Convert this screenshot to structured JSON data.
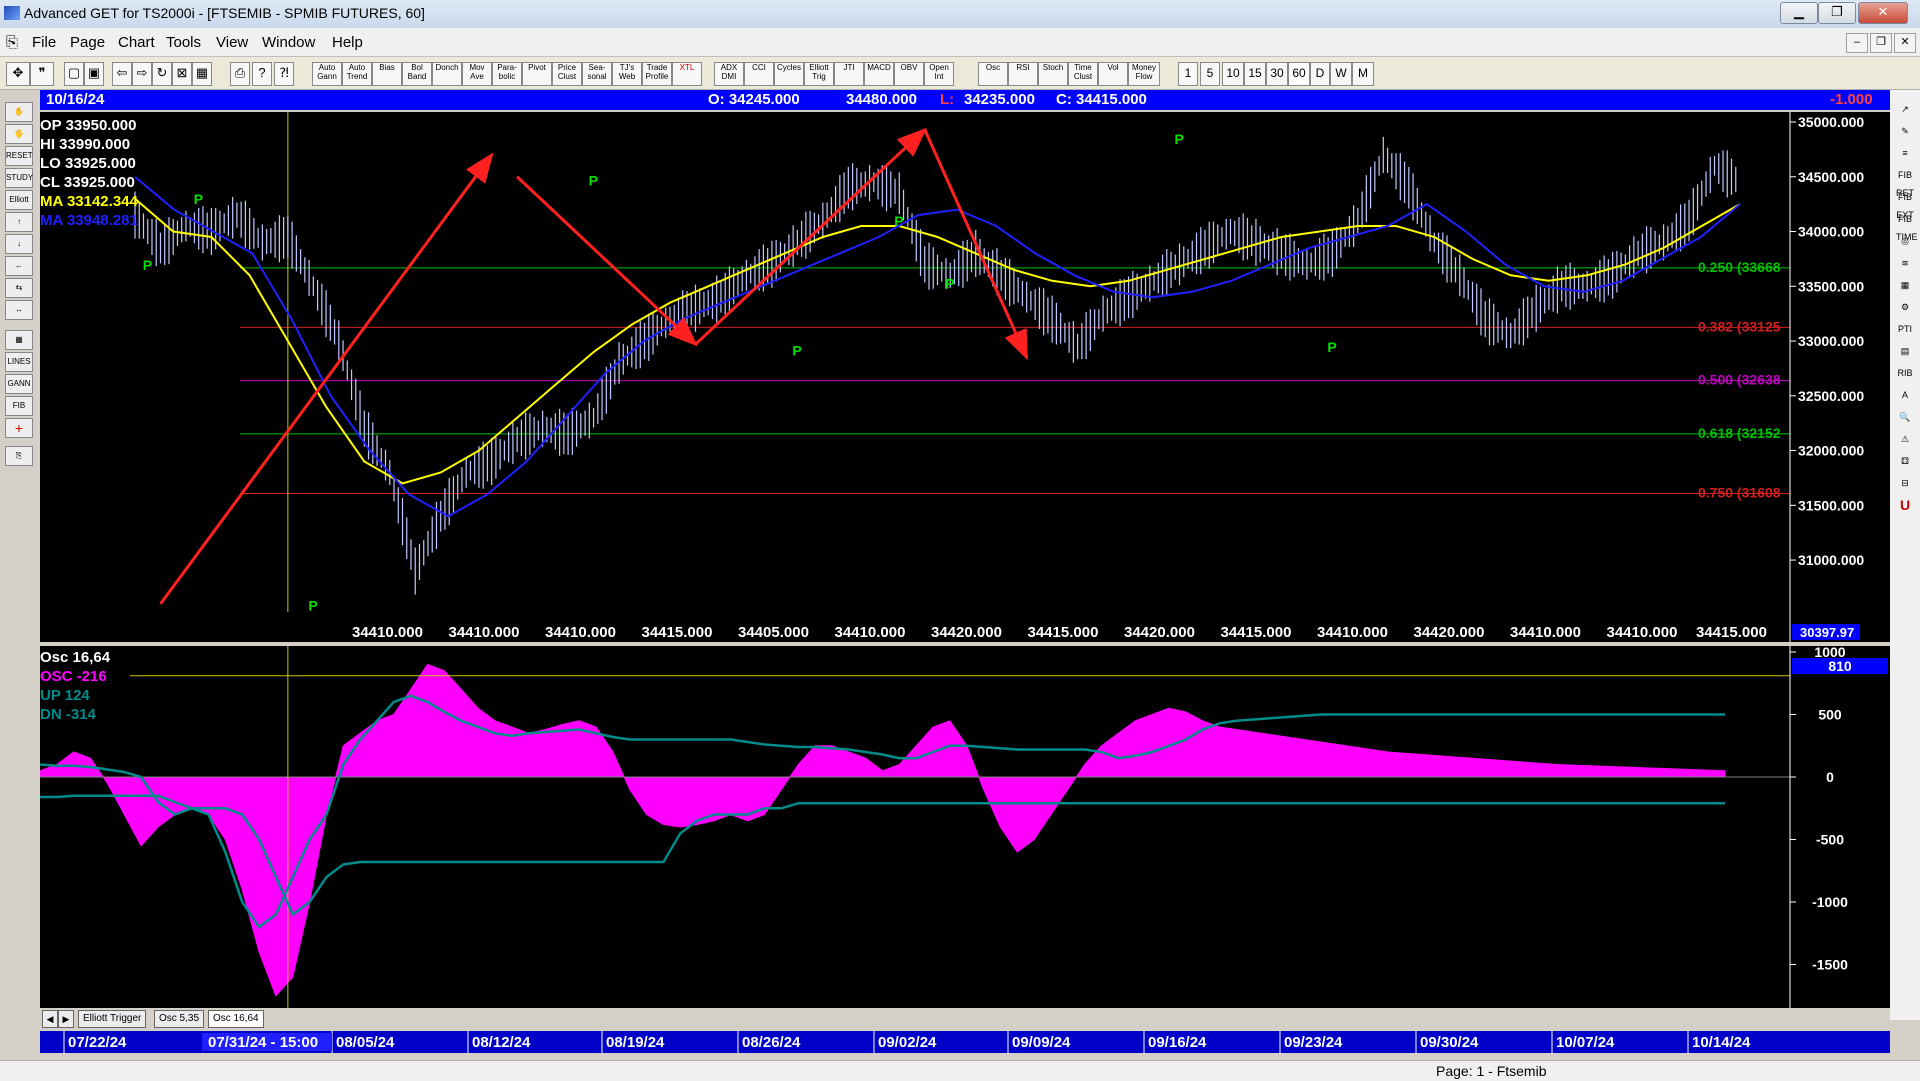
{
  "window": {
    "title": "Advanced GET for TS2000i - [FTSEMIB - SPMIB FUTURES, 60]",
    "minimize": "▁",
    "restore": "❐",
    "close": "✕"
  },
  "menu": [
    "File",
    "Page",
    "Chart",
    "Tools",
    "View",
    "Window",
    "Help"
  ],
  "toolbar": {
    "studies": [
      "Auto Gann",
      "Auto Trend",
      "Bias",
      "Bol Band",
      "Donch",
      "Mov Ave",
      "Para- bolic",
      "Pivot",
      "Price Clust",
      "Sea- sonal",
      "TJ's Web",
      "Trade Profile",
      "XTL",
      "ADX DMI",
      "CCI",
      "Cycles",
      "Elliott Trig",
      "JTI",
      "MACD",
      "OBV",
      "Open Int",
      "Osc",
      "RSI",
      "Stoch",
      "Time Clust",
      "Vol",
      "Money Flow"
    ],
    "intervals": [
      "1",
      "5",
      "10",
      "15",
      "30",
      "60",
      "D",
      "W",
      "M"
    ]
  },
  "info": {
    "date": "10/16/24",
    "open": "O: 34245.000",
    "high": "34480.000",
    "low_prefix": "L:",
    "low": "34235.000",
    "close": "C: 34415.000",
    "change": "-1.000"
  },
  "legend": {
    "op": "OP  33950.000",
    "hi": "HI   33990.000",
    "lo": "LO  33925.000",
    "cl": "CL  33925.000",
    "ma1": "MA  33142.344",
    "ma2": "MA  33948.281"
  },
  "colors": {
    "price": "#c0c8ff",
    "ma_yellow": "#ffff00",
    "ma_blue": "#2020ff",
    "arrow": "#ff2020",
    "pivot": "#00e000",
    "osc": "#ff00ff",
    "osc_line": "#008b8b",
    "fib_green": "#00c000",
    "fib_red": "#d02020",
    "fib_purple": "#c000c0"
  },
  "chart_data": [
    {
      "type": "line",
      "ylim": [
        30397.97,
        35000
      ],
      "yticks": [
        {
          "v": 35000,
          "label": "35000.000"
        },
        {
          "v": 34500,
          "label": "34500.000"
        },
        {
          "v": 34000,
          "label": "34000.000"
        },
        {
          "v": 33500,
          "label": "33500.000"
        },
        {
          "v": 33000,
          "label": "33000.000"
        },
        {
          "v": 32500,
          "label": "32500.000"
        },
        {
          "v": 32000,
          "label": "32000.000"
        },
        {
          "v": 31500,
          "label": "31500.000"
        },
        {
          "v": 31000,
          "label": "31000.000"
        }
      ],
      "y_bottom_label": "30397.97",
      "series": [
        {
          "values": [
            34150,
            33850,
            34050,
            34000,
            34150,
            33900,
            33950,
            33500,
            33000,
            32200,
            31800,
            30900,
            31400,
            31800,
            31900,
            32100,
            32200,
            32150,
            32300,
            32800,
            33000,
            33200,
            33300,
            33400,
            33600,
            33700,
            33900,
            34100,
            34400,
            34450,
            34350,
            33700,
            33600,
            33800,
            33600,
            33400,
            33200,
            32950,
            33250,
            33400,
            33550,
            33700,
            33850,
            34000,
            33900,
            33800,
            33700,
            33800,
            34100,
            34700,
            34400,
            33900,
            33600,
            33200,
            33050,
            33300,
            33500,
            33500,
            33600,
            33800,
            33900,
            34100,
            34600,
            34450
          ]
        },
        {
          "values": [
            34300,
            34000,
            33950,
            33600,
            33000,
            32400,
            31900,
            31700,
            31800,
            32000,
            32300,
            32600,
            32900,
            33150,
            33350,
            33500,
            33650,
            33800,
            33950,
            34050,
            34050,
            33950,
            33800,
            33650,
            33550,
            33500,
            33550,
            33650,
            33750,
            33850,
            33950,
            34000,
            34050,
            34050,
            33950,
            33750,
            33600,
            33550,
            33600,
            33700,
            33850,
            34050,
            34250
          ]
        },
        {
          "values": [
            34500,
            34200,
            34000,
            33800,
            33200,
            32500,
            32000,
            31600,
            31400,
            31600,
            31900,
            32300,
            32700,
            33000,
            33200,
            33350,
            33500,
            33650,
            33800,
            33950,
            34150,
            34200,
            34050,
            33800,
            33600,
            33450,
            33400,
            33450,
            33550,
            33700,
            33850,
            33950,
            34050,
            34250,
            34000,
            33700,
            33500,
            33450,
            33550,
            33750,
            33950,
            34250
          ]
        }
      ],
      "trendlines": [
        [
          1,
          30600,
          14,
          34700
        ],
        [
          15,
          34500,
          22,
          32970
        ],
        [
          22,
          32970,
          31,
          34930
        ],
        [
          31,
          34930,
          35,
          32850
        ]
      ],
      "pivots": [
        {
          "x": 0.5,
          "y": 33650,
          "label": "P"
        },
        {
          "x": 2.5,
          "y": 34250,
          "label": "P"
        },
        {
          "x": 7,
          "y": 30540,
          "label": "P"
        },
        {
          "x": 18,
          "y": 34420,
          "label": "P"
        },
        {
          "x": 26,
          "y": 32870,
          "label": "P"
        },
        {
          "x": 30,
          "y": 34050,
          "label": "P"
        },
        {
          "x": 32,
          "y": 33480,
          "label": "P"
        },
        {
          "x": 41,
          "y": 34800,
          "label": "P"
        },
        {
          "x": 47,
          "y": 32900,
          "label": "P"
        }
      ],
      "fib_levels": [
        {
          "v": 33668,
          "label": "0.250 (33668"
        },
        {
          "v": 33125,
          "label": "0.382 (33125"
        },
        {
          "v": 32638,
          "label": "0.500 (32638"
        },
        {
          "v": 32152,
          "label": "0.618 (32152"
        },
        {
          "v": 31608,
          "label": "0.750 (31608"
        }
      ],
      "time_cursor_x": 6,
      "bottom_labels": [
        "34410.000",
        "34410.000",
        "34410.000",
        "34415.000",
        "34405.000",
        "34410.000",
        "34420.000",
        "34415.000",
        "34420.000",
        "34415.000",
        "34410.000",
        "34420.000",
        "34410.000",
        "34410.000",
        "34415.000"
      ]
    },
    {
      "type": "area",
      "title": "Osc 16,64",
      "legend": {
        "osc": "OSC -216",
        "up": "UP   124",
        "dn": "DN   -314"
      },
      "ylim": [
        -1800,
        1000
      ],
      "yticks": [
        {
          "v": 1000,
          "label": "1000"
        },
        {
          "v": 500,
          "label": "500"
        },
        {
          "v": 0,
          "label": "0"
        },
        {
          "v": -500,
          "label": "-500"
        },
        {
          "v": -1000,
          "label": "-1000"
        },
        {
          "v": -1500,
          "label": "-1500"
        }
      ],
      "readout": "810",
      "threshold": 810,
      "x": [
        0,
        2,
        4,
        6,
        8,
        10,
        12,
        14,
        16,
        18,
        20,
        22,
        24,
        26,
        28,
        30,
        32,
        34,
        36,
        38,
        40,
        42,
        44,
        46,
        48,
        50,
        52,
        54,
        56,
        58,
        60,
        62,
        64,
        66,
        68,
        70,
        72,
        74,
        76,
        78,
        80,
        82,
        84,
        86,
        88,
        90,
        92,
        94,
        96,
        98,
        100,
        102,
        104,
        106,
        108,
        110,
        112,
        114,
        116,
        118,
        120,
        122,
        124,
        126,
        128,
        130,
        132,
        134,
        136,
        138,
        140,
        142,
        144,
        146,
        148,
        150,
        152,
        154,
        156,
        158,
        160,
        162,
        164,
        166,
        168,
        170,
        172,
        174,
        176,
        178,
        180,
        182,
        184,
        186,
        188,
        190,
        192,
        194,
        196,
        198,
        200
      ],
      "osc": [
        50,
        100,
        200,
        150,
        -50,
        -300,
        -550,
        -400,
        -300,
        -250,
        -300,
        -500,
        -900,
        -1400,
        -1750,
        -1600,
        -1000,
        -300,
        250,
        350,
        450,
        500,
        700,
        900,
        850,
        700,
        550,
        450,
        400,
        350,
        380,
        420,
        450,
        400,
        200,
        -100,
        -300,
        -380,
        -400,
        -380,
        -350,
        -300,
        -350,
        -300,
        -100,
        100,
        250,
        250,
        200,
        150,
        50,
        100,
        250,
        400,
        450,
        250,
        -100,
        -400,
        -600,
        -500,
        -300,
        -100,
        100,
        250,
        350,
        450,
        500,
        550,
        520,
        450,
        400,
        380,
        360,
        340,
        320,
        300,
        280,
        260,
        240,
        220,
        200,
        190,
        180,
        170,
        160,
        150,
        140,
        130,
        120,
        110,
        100,
        95,
        90,
        85,
        80,
        75,
        70,
        65,
        60,
        55,
        50
      ],
      "up_line": [
        100,
        90,
        90,
        80,
        60,
        40,
        0,
        -200,
        -300,
        -250,
        -300,
        -600,
        -1000,
        -1200,
        -1100,
        -800,
        -500,
        -300,
        100,
        300,
        450,
        600,
        650,
        600,
        520,
        450,
        400,
        350,
        330,
        350,
        360,
        370,
        380,
        350,
        320,
        300,
        300,
        300,
        300,
        300,
        300,
        300,
        280,
        260,
        250,
        240,
        240,
        230,
        220,
        200,
        180,
        150,
        150,
        200,
        250,
        250,
        240,
        230,
        220,
        220,
        220,
        220,
        220,
        200,
        150,
        170,
        200,
        250,
        300,
        380,
        430,
        450,
        460,
        470,
        480,
        490,
        500,
        500,
        500,
        500,
        500,
        500,
        500,
        500,
        500,
        500,
        500,
        500,
        500,
        500,
        500,
        500,
        500,
        500,
        500,
        500,
        500,
        500,
        500,
        500,
        500
      ],
      "dn_line": [
        -160,
        -160,
        -150,
        -150,
        -150,
        -150,
        -150,
        -150,
        -200,
        -250,
        -250,
        -250,
        -300,
        -500,
        -800,
        -1100,
        -1000,
        -800,
        -700,
        -680,
        -680,
        -680,
        -680,
        -680,
        -680,
        -680,
        -680,
        -680,
        -680,
        -680,
        -680,
        -680,
        -680,
        -680,
        -680,
        -680,
        -680,
        -680,
        -450,
        -350,
        -300,
        -300,
        -300,
        -250,
        -250,
        -210,
        -210,
        -210,
        -210,
        -210,
        -210,
        -210,
        -210,
        -210,
        -210,
        -210,
        -210,
        -210,
        -210,
        -210,
        -210,
        -210,
        -210,
        -210,
        -210,
        -210,
        -210,
        -210,
        -210,
        -210,
        -210,
        -210,
        -210,
        -210,
        -210,
        -210,
        -210,
        -210,
        -210,
        -210,
        -210,
        -210,
        -210,
        -210,
        -210,
        -210,
        -210,
        -210,
        -210,
        -210,
        -210,
        -210,
        -210,
        -210,
        -210,
        -210,
        -210,
        -210,
        -210,
        -210,
        -210
      ]
    }
  ],
  "dates": {
    "labels": [
      "07/22/24",
      "08/05/24",
      "08/12/24",
      "08/19/24",
      "08/26/24",
      "09/02/24",
      "09/09/24",
      "09/16/24",
      "09/23/24",
      "09/30/24",
      "10/07/24",
      "10/14/24"
    ],
    "cursor": "07/31/24 - 15:00"
  },
  "tabs": [
    "Elliott Trigger",
    "Osc 5,35",
    "Osc 16,64"
  ],
  "status": "Page: 1 - Ftsemib",
  "right_tools": [
    "↗",
    "✎",
    "≡",
    "FIB RET",
    "FIB EXT",
    "FIB TIME",
    "◎",
    "≋",
    "▦",
    "⚙",
    "PTI",
    "▤",
    "RIB",
    "A",
    "🔍",
    "⚠",
    "⚃",
    "⊟",
    "U"
  ],
  "left_tools": [
    "✋",
    "🖐",
    "RESET",
    "STUDY",
    "Elliott",
    "↑",
    "↓",
    "←",
    "⇆",
    "↔",
    "▦",
    "LINES",
    "GANN",
    "FIB",
    "+",
    "⎘"
  ]
}
